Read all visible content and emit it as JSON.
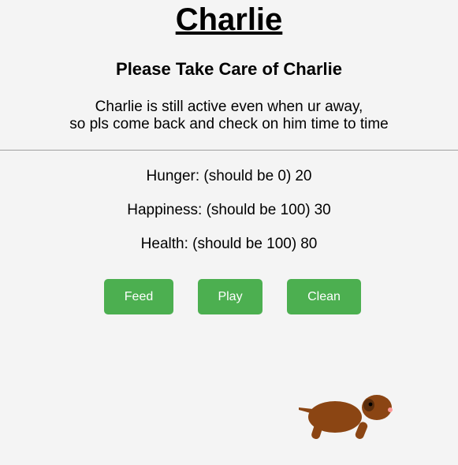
{
  "pet": {
    "name": "Charlie",
    "subtitle": "Please Take Care of Charlie",
    "message_line1": "Charlie is still active even when ur away,",
    "message_line2": "so pls come back and check on him time to time",
    "body_color": "#8b4513",
    "ear_color": "#5a2d0c",
    "nose_color": "#ff9999"
  },
  "stats": {
    "hunger_label": "Hunger: (should be 0)",
    "hunger": 20,
    "happiness_label": "Happiness: (should be 100)",
    "happiness": 30,
    "health_label": "Health: (should be 100)",
    "health": 80
  },
  "actions": {
    "feed_label": "Feed",
    "play_label": "Play",
    "clean_label": "Clean",
    "button_color": "#4caf50"
  }
}
